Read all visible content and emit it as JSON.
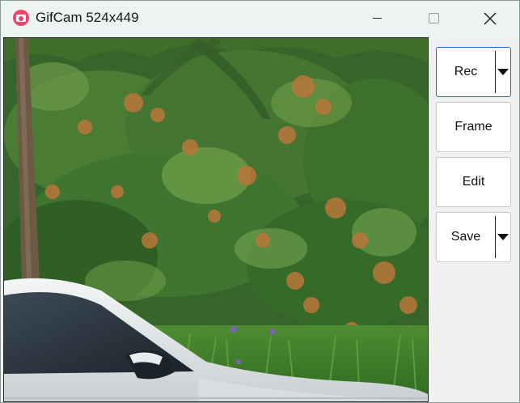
{
  "window": {
    "title": "GifCam 524x449",
    "icon": "camera-record-icon",
    "controls": [
      "minimize-icon",
      "maximize-icon",
      "close-icon"
    ]
  },
  "capture_area": {
    "content": "Live screen capture region showing green foliage, a palm trunk and the front of a white car"
  },
  "buttons": {
    "rec": {
      "label": "Rec",
      "has_dropdown": true,
      "focused": true
    },
    "frame": {
      "label": "Frame"
    },
    "edit": {
      "label": "Edit"
    },
    "save": {
      "label": "Save",
      "has_dropdown": true
    }
  },
  "colors": {
    "accent_focus": "#1f6fc8",
    "app_icon": "#f0466a",
    "titlebar": "#edf3ee",
    "panel": "#f0f0f0"
  }
}
